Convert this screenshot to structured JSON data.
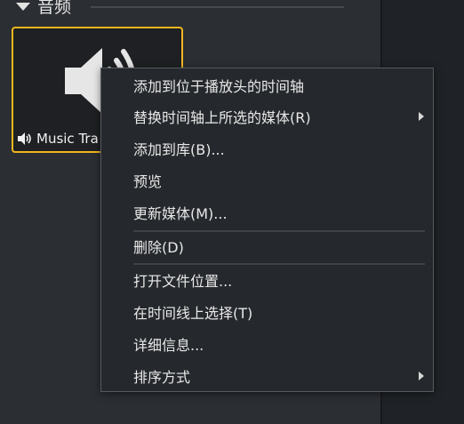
{
  "panel": {
    "section_title": "音频"
  },
  "media_tile": {
    "name": "Music Tra"
  },
  "context_menu": {
    "items": [
      {
        "label": "添加到位于播放头的时间轴",
        "has_submenu": false
      },
      {
        "label": "替换时间轴上所选的媒体(R)",
        "has_submenu": true
      },
      {
        "label": "添加到库(B)...",
        "has_submenu": false
      },
      {
        "label": "预览",
        "has_submenu": false
      },
      {
        "label": "更新媒体(M)...",
        "has_submenu": false
      },
      {
        "label": "删除(D)",
        "has_submenu": false
      },
      {
        "label": "打开文件位置...",
        "has_submenu": false
      },
      {
        "label": "在时间线上选择(T)",
        "has_submenu": false
      },
      {
        "label": "详细信息...",
        "has_submenu": false
      },
      {
        "label": "排序方式",
        "has_submenu": true
      }
    ]
  },
  "colors": {
    "selection_border": "#f2b620",
    "menu_background": "#25282c",
    "panel_background": "#2b2e33"
  },
  "icons": {
    "section_toggle": "caret-down-icon",
    "tile_thumbnail": "speaker-icon",
    "tile_type": "audio-icon",
    "submenu": "chevron-right-icon"
  }
}
